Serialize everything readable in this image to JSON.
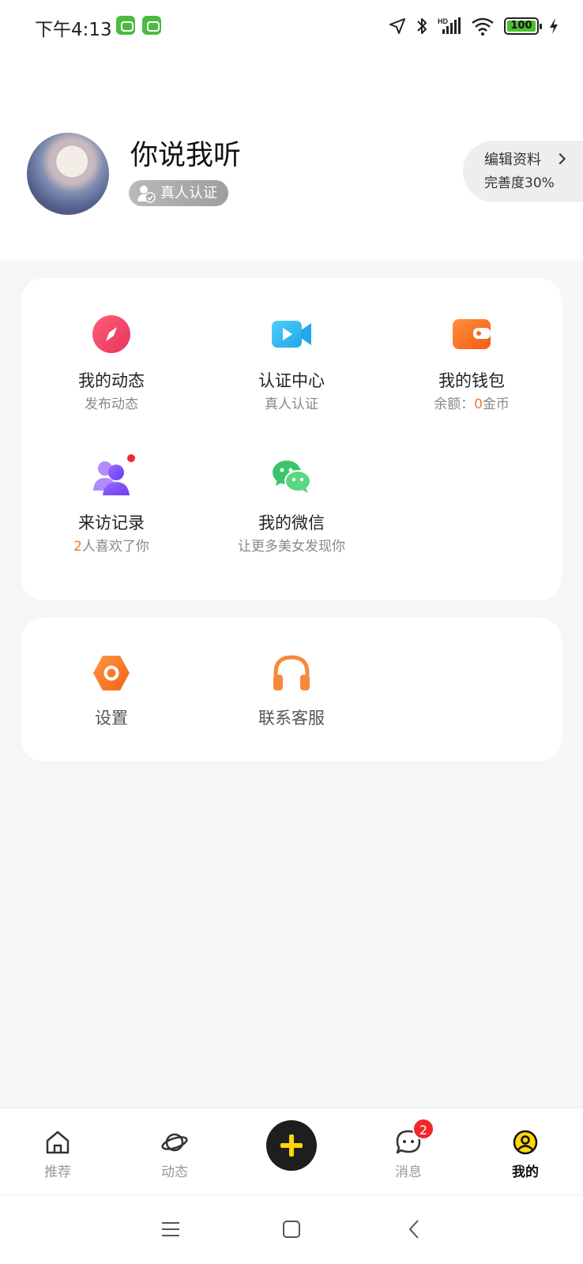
{
  "status_bar": {
    "time": "下午4:13",
    "battery": "100"
  },
  "profile": {
    "username": "你说我听",
    "verify_badge": "真人认证",
    "edit_label": "编辑资料",
    "completion": "完善度30%"
  },
  "main_card": {
    "items": [
      {
        "title": "我的动态",
        "sub": "发布动态"
      },
      {
        "title": "认证中心",
        "sub": "真人认证"
      },
      {
        "title": "我的钱包",
        "sub_prefix": "余额：",
        "sub_value": "0",
        "sub_suffix": "金币"
      },
      {
        "title": "来访记录",
        "sub_value": "2",
        "sub_suffix": "人喜欢了你"
      },
      {
        "title": "我的微信",
        "sub": "让更多美女发现你"
      }
    ]
  },
  "service_card": {
    "items": [
      {
        "title": "设置"
      },
      {
        "title": "联系客服"
      }
    ]
  },
  "tab_bar": {
    "tabs": [
      {
        "label": "推荐"
      },
      {
        "label": "动态"
      },
      {
        "label": "消息",
        "badge": "2"
      },
      {
        "label": "我的"
      }
    ]
  },
  "colors": {
    "accent_yellow": "#ffd60a",
    "highlight_orange": "#f07a2a",
    "badge_red": "#f1272b"
  }
}
